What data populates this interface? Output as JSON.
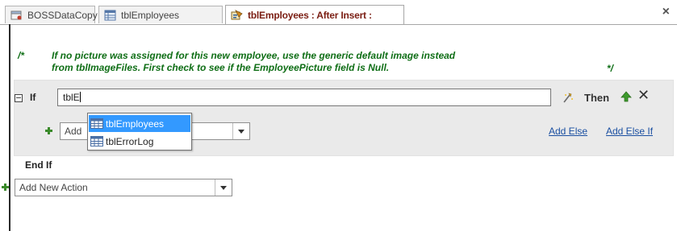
{
  "tabs": [
    {
      "label": "BOSSDataCopy",
      "icon": "database-icon"
    },
    {
      "label": "tblEmployees",
      "icon": "table-icon"
    },
    {
      "label": "tblEmployees : After Insert :",
      "icon": "macro-icon",
      "active": true
    }
  ],
  "close_glyph": "×",
  "comment": {
    "open": "/*",
    "line1": "If no picture was assigned for this new employee, use the generic default image instead",
    "line2": "from tblImageFiles. First check to see if the EmployeePicture field is Null.",
    "close": "*/"
  },
  "if_block": {
    "keyword": "If",
    "condition_value": "tblE",
    "then_label": "Then",
    "delete_glyph": "✕",
    "add_action_value": "Add",
    "add_else": "Add Else",
    "add_else_if": "Add Else If",
    "end_if": "End If"
  },
  "autocomplete": {
    "items": [
      {
        "label": "tblEmployees",
        "selected": true,
        "icon": "table-icon"
      },
      {
        "label": "tblErrorLog",
        "selected": false,
        "icon": "table-icon"
      }
    ]
  },
  "bottom_action": {
    "value": "Add New Action"
  },
  "colors": {
    "comment": "#0f6e16",
    "active_tab_text": "#7a1d12",
    "link": "#1a4fa1",
    "selection": "#3399ff",
    "block_bg": "#eaeaea"
  }
}
